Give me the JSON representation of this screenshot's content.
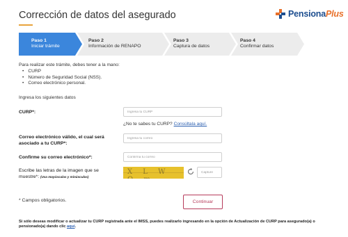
{
  "header": {
    "title": "Corrección de datos del asegurado",
    "logo_text": "Pensiona",
    "logo_accent": "Plus"
  },
  "steps": [
    {
      "num": "Paso 1",
      "label": "Iniciar trámite",
      "active": true
    },
    {
      "num": "Paso 2",
      "label": "Información de RENAPO",
      "active": false
    },
    {
      "num": "Paso 3",
      "label": "Captura de datos",
      "active": false
    },
    {
      "num": "Paso 4",
      "label": "Confirmar datos",
      "active": false
    }
  ],
  "intro": {
    "text": "Para realizar este trámite, debes tener a la mano:",
    "requirements": [
      "CURP",
      "Número de Seguridad Social (NSS).",
      "Correo electrónico personal."
    ],
    "instruction": "Ingresa los siguientes datos"
  },
  "form": {
    "curp_label": "CURP*:",
    "curp_placeholder": "Ingresa tu CURP",
    "curp_help": "¿No te sabes tu CURP?",
    "curp_help_link": "Consúltala aquí.",
    "email_label": "Correo electrónico válido, el cual será asociado a tu CURP*:",
    "email_placeholder": "Ingresa tu correo",
    "confirm_label": "Confirme su correo electrónico*:",
    "confirm_placeholder": "Confirma tu correo",
    "captcha_label": "Escribe las letras de la imagen que se muestre*:",
    "captcha_hint": "(Usa mayúsculas y minúsculas)",
    "captcha_text": "X L W O m",
    "captcha_placeholder": "Capture",
    "required_note": "* Campos obligatorios.",
    "submit_label": "Continuar"
  },
  "footer": {
    "text": "Si sólo deseas modificar o actualizar tu CURP registrada ante el IMSS, puedes realizarlo ingresando en la opción de Actualización de CURP para asegurado(a) o pensionado(a) dando clic",
    "link": "aquí",
    "end": "."
  },
  "colors": {
    "active_step": "#3b86dc",
    "inactive_step": "#ececec",
    "accent": "#e8a33c",
    "brand_blue": "#1d4e8f",
    "button_border": "#b63a5a",
    "captcha_bg": "#e7c12c"
  }
}
